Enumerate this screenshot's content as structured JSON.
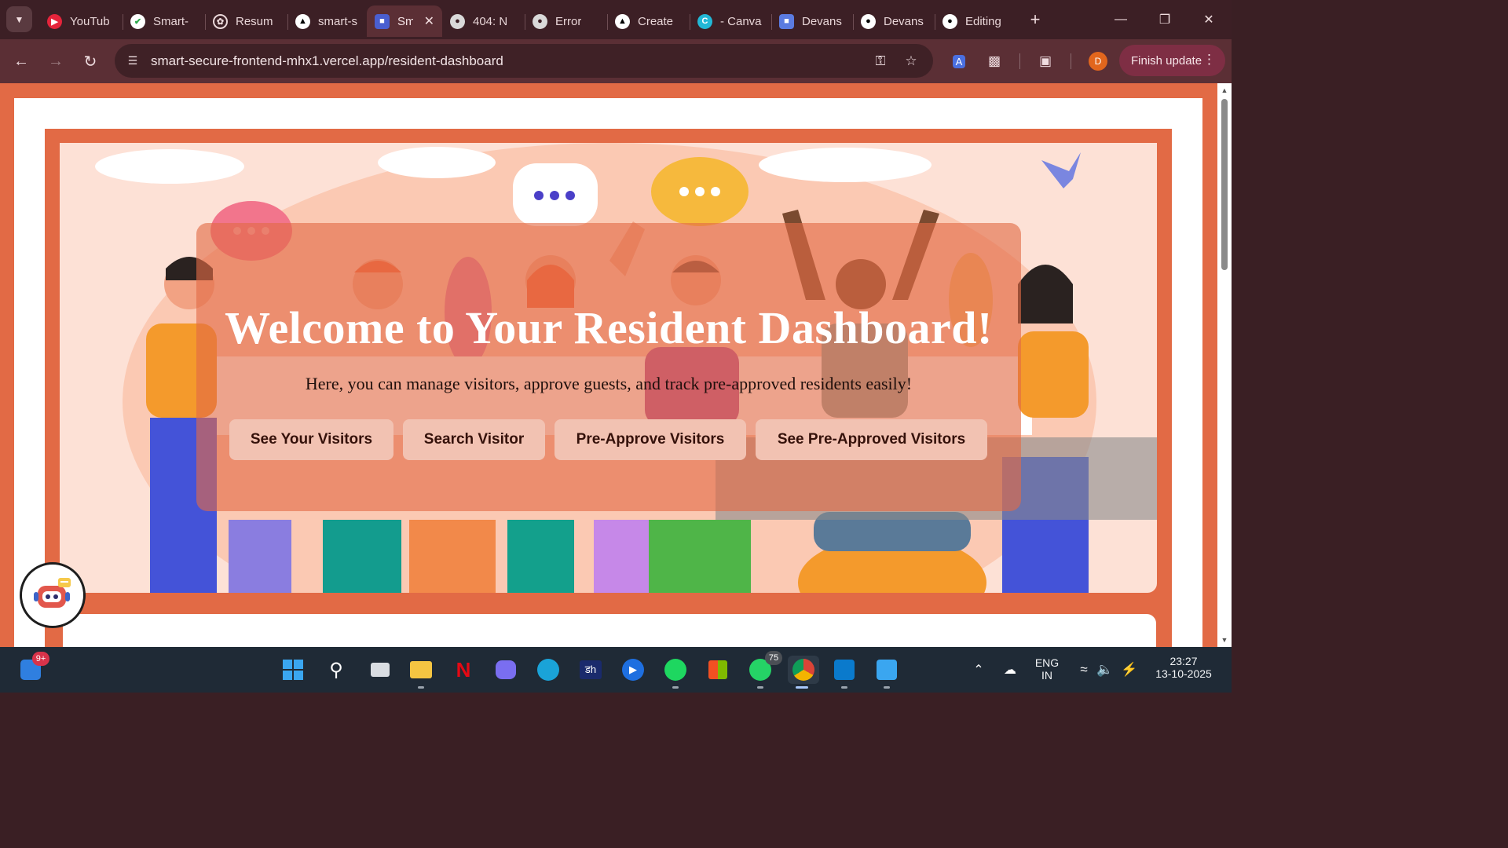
{
  "browser": {
    "tabs": [
      {
        "label": "YouTub",
        "icon": "youtube-icon",
        "color": "#e5243b"
      },
      {
        "label": "Smart-",
        "icon": "verified-icon",
        "color": "#2aa84a"
      },
      {
        "label": "Resum",
        "icon": "openai-icon",
        "color": "#ffffff"
      },
      {
        "label": "smart-s",
        "icon": "vercel-icon",
        "color": "#ffffff"
      },
      {
        "label": "Sm",
        "icon": "shield-icon",
        "color": "#4a5fd0",
        "active": true
      },
      {
        "label": "404: N",
        "icon": "globe-icon",
        "color": "#d9d9d9"
      },
      {
        "label": "Error",
        "icon": "globe-icon",
        "color": "#d9d9d9"
      },
      {
        "label": "Create",
        "icon": "vercel-icon",
        "color": "#ffffff"
      },
      {
        "label": "- Canva",
        "icon": "canva-icon",
        "color": "#22b8d6"
      },
      {
        "label": "Devans",
        "icon": "app-icon",
        "color": "#5b7be0"
      },
      {
        "label": "Devans",
        "icon": "github-icon",
        "color": "#ffffff"
      },
      {
        "label": "Editing",
        "icon": "github-icon",
        "color": "#ffffff"
      }
    ],
    "url": "smart-secure-frontend-mhx1.vercel.app/resident-dashboard",
    "profile_initial": "D",
    "finish_update_label": "Finish update"
  },
  "page": {
    "heading": "Welcome to Your Resident Dashboard!",
    "subheading": "Here, you can manage visitors, approve guests, and track pre-approved residents easily!",
    "buttons": [
      {
        "label": "See Your Visitors"
      },
      {
        "label": "Search Visitor"
      },
      {
        "label": "Pre-Approve Visitors"
      },
      {
        "label": "See Pre-Approved Visitors"
      }
    ],
    "accent_color": "#e26a45"
  },
  "taskbar": {
    "widgets_badge": "9+",
    "whatsapp_badge": "75",
    "language": "ENG",
    "region": "IN",
    "time": "23:27",
    "date": "13-10-2025"
  }
}
